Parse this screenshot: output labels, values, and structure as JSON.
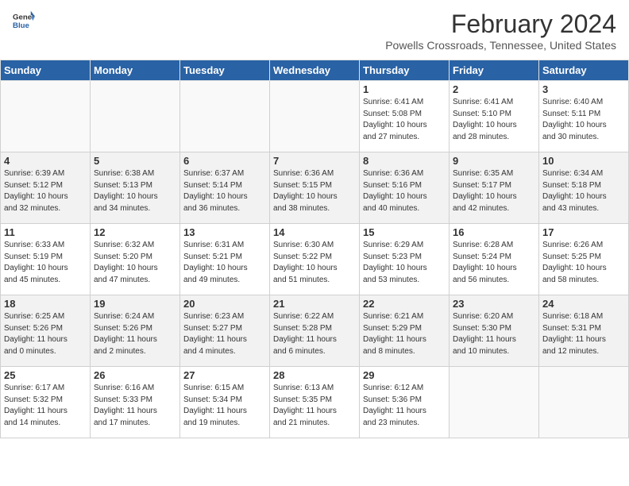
{
  "header": {
    "logo_general": "General",
    "logo_blue": "Blue",
    "month_year": "February 2024",
    "location": "Powells Crossroads, Tennessee, United States"
  },
  "weekdays": [
    "Sunday",
    "Monday",
    "Tuesday",
    "Wednesday",
    "Thursday",
    "Friday",
    "Saturday"
  ],
  "weeks": [
    [
      {
        "day": "",
        "info": ""
      },
      {
        "day": "",
        "info": ""
      },
      {
        "day": "",
        "info": ""
      },
      {
        "day": "",
        "info": ""
      },
      {
        "day": "1",
        "info": "Sunrise: 6:41 AM\nSunset: 5:08 PM\nDaylight: 10 hours\nand 27 minutes."
      },
      {
        "day": "2",
        "info": "Sunrise: 6:41 AM\nSunset: 5:10 PM\nDaylight: 10 hours\nand 28 minutes."
      },
      {
        "day": "3",
        "info": "Sunrise: 6:40 AM\nSunset: 5:11 PM\nDaylight: 10 hours\nand 30 minutes."
      }
    ],
    [
      {
        "day": "4",
        "info": "Sunrise: 6:39 AM\nSunset: 5:12 PM\nDaylight: 10 hours\nand 32 minutes."
      },
      {
        "day": "5",
        "info": "Sunrise: 6:38 AM\nSunset: 5:13 PM\nDaylight: 10 hours\nand 34 minutes."
      },
      {
        "day": "6",
        "info": "Sunrise: 6:37 AM\nSunset: 5:14 PM\nDaylight: 10 hours\nand 36 minutes."
      },
      {
        "day": "7",
        "info": "Sunrise: 6:36 AM\nSunset: 5:15 PM\nDaylight: 10 hours\nand 38 minutes."
      },
      {
        "day": "8",
        "info": "Sunrise: 6:36 AM\nSunset: 5:16 PM\nDaylight: 10 hours\nand 40 minutes."
      },
      {
        "day": "9",
        "info": "Sunrise: 6:35 AM\nSunset: 5:17 PM\nDaylight: 10 hours\nand 42 minutes."
      },
      {
        "day": "10",
        "info": "Sunrise: 6:34 AM\nSunset: 5:18 PM\nDaylight: 10 hours\nand 43 minutes."
      }
    ],
    [
      {
        "day": "11",
        "info": "Sunrise: 6:33 AM\nSunset: 5:19 PM\nDaylight: 10 hours\nand 45 minutes."
      },
      {
        "day": "12",
        "info": "Sunrise: 6:32 AM\nSunset: 5:20 PM\nDaylight: 10 hours\nand 47 minutes."
      },
      {
        "day": "13",
        "info": "Sunrise: 6:31 AM\nSunset: 5:21 PM\nDaylight: 10 hours\nand 49 minutes."
      },
      {
        "day": "14",
        "info": "Sunrise: 6:30 AM\nSunset: 5:22 PM\nDaylight: 10 hours\nand 51 minutes."
      },
      {
        "day": "15",
        "info": "Sunrise: 6:29 AM\nSunset: 5:23 PM\nDaylight: 10 hours\nand 53 minutes."
      },
      {
        "day": "16",
        "info": "Sunrise: 6:28 AM\nSunset: 5:24 PM\nDaylight: 10 hours\nand 56 minutes."
      },
      {
        "day": "17",
        "info": "Sunrise: 6:26 AM\nSunset: 5:25 PM\nDaylight: 10 hours\nand 58 minutes."
      }
    ],
    [
      {
        "day": "18",
        "info": "Sunrise: 6:25 AM\nSunset: 5:26 PM\nDaylight: 11 hours\nand 0 minutes."
      },
      {
        "day": "19",
        "info": "Sunrise: 6:24 AM\nSunset: 5:26 PM\nDaylight: 11 hours\nand 2 minutes."
      },
      {
        "day": "20",
        "info": "Sunrise: 6:23 AM\nSunset: 5:27 PM\nDaylight: 11 hours\nand 4 minutes."
      },
      {
        "day": "21",
        "info": "Sunrise: 6:22 AM\nSunset: 5:28 PM\nDaylight: 11 hours\nand 6 minutes."
      },
      {
        "day": "22",
        "info": "Sunrise: 6:21 AM\nSunset: 5:29 PM\nDaylight: 11 hours\nand 8 minutes."
      },
      {
        "day": "23",
        "info": "Sunrise: 6:20 AM\nSunset: 5:30 PM\nDaylight: 11 hours\nand 10 minutes."
      },
      {
        "day": "24",
        "info": "Sunrise: 6:18 AM\nSunset: 5:31 PM\nDaylight: 11 hours\nand 12 minutes."
      }
    ],
    [
      {
        "day": "25",
        "info": "Sunrise: 6:17 AM\nSunset: 5:32 PM\nDaylight: 11 hours\nand 14 minutes."
      },
      {
        "day": "26",
        "info": "Sunrise: 6:16 AM\nSunset: 5:33 PM\nDaylight: 11 hours\nand 17 minutes."
      },
      {
        "day": "27",
        "info": "Sunrise: 6:15 AM\nSunset: 5:34 PM\nDaylight: 11 hours\nand 19 minutes."
      },
      {
        "day": "28",
        "info": "Sunrise: 6:13 AM\nSunset: 5:35 PM\nDaylight: 11 hours\nand 21 minutes."
      },
      {
        "day": "29",
        "info": "Sunrise: 6:12 AM\nSunset: 5:36 PM\nDaylight: 11 hours\nand 23 minutes."
      },
      {
        "day": "",
        "info": ""
      },
      {
        "day": "",
        "info": ""
      }
    ]
  ]
}
